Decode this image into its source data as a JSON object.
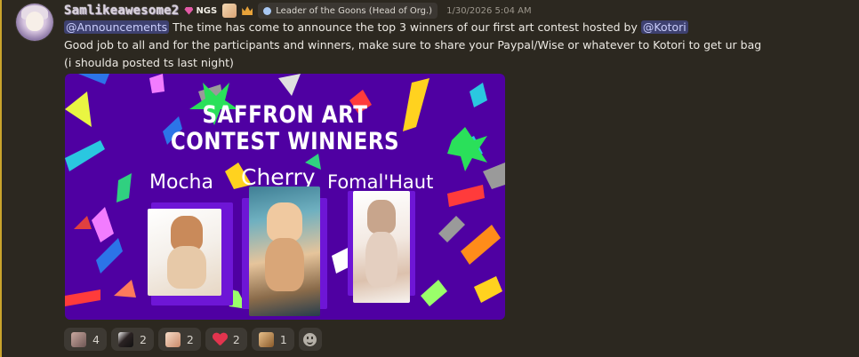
{
  "message": {
    "username": "Samlikeawesome2",
    "tag": "NGS",
    "role": "Leader of the Goons (Head of Org.)",
    "timestamp": "1/30/2026 5:04 AM",
    "mention_announcements": "@Announcements",
    "line1_text": " The time has come to announce the top 3 winners of our first art contest hosted by ",
    "mention_kotori": "@Kotori",
    "line2": "Good job to all and for the participants and winners, make sure to share your Paypal/Wise or whatever to Kotori to get ur bag",
    "line3": "(i shoulda posted ts last night)"
  },
  "embed": {
    "title_line1": "SAFFRON ART",
    "title_line2": "CONTEST WINNERS",
    "winners": [
      "Mocha",
      "Cherry",
      "Fomal'Haut"
    ],
    "colors": {
      "background": "#4f00a2",
      "frame": "#6e16d6"
    }
  },
  "reactions": [
    {
      "icon": "avatar-emoji-icon",
      "count": "4",
      "color": "#8a6f6a"
    },
    {
      "icon": "dark-avatar-emoji-icon",
      "count": "2",
      "color": "#2a2222"
    },
    {
      "icon": "sticker-emoji-icon",
      "count": "2",
      "color": "#e8b8a0"
    },
    {
      "icon": "heart-icon",
      "count": "2",
      "color": "#e2344e"
    },
    {
      "icon": "cat-emoji-icon",
      "count": "1",
      "color": "#c98d4a"
    }
  ]
}
